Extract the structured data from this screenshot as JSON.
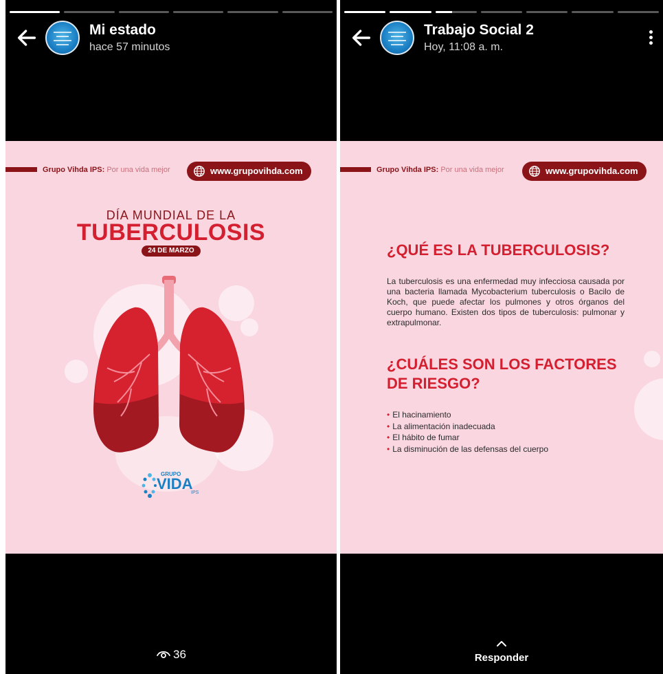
{
  "left": {
    "progress": [
      100,
      0,
      0,
      0,
      0,
      0
    ],
    "header": {
      "name": "Mi estado",
      "time": "hace 57 minutos"
    },
    "card": {
      "brand_name": "Grupo Vihda IPS:",
      "brand_tagline": "Por una vida mejor",
      "url": "www.grupovihda.com",
      "title_top": "DÍA MUNDIAL DE LA",
      "title_main": "TUBERCULOSIS",
      "date": "24 DE MARZO",
      "logo_small": "GRUPO",
      "logo_main": "VIDA",
      "logo_sub": "IPS"
    },
    "views": "36"
  },
  "right": {
    "progress": [
      100,
      100,
      40,
      0,
      0,
      0,
      0
    ],
    "header": {
      "name": "Trabajo Social 2",
      "time": "Hoy, 11:08 a. m."
    },
    "card": {
      "brand_name": "Grupo Vihda IPS:",
      "brand_tagline": "Por una vida mejor",
      "url": "www.grupovihda.com",
      "q1": "¿QUÉ ES LA TUBERCULOSIS?",
      "p1": "La tuberculosis es una enfermedad muy infecciosa causada por una bacteria llamada Mycobacterium tuberculosis o Bacilo de Koch, que puede afectar los pulmones y otros órganos del cuerpo humano. Existen dos tipos de tuberculosis: pulmonar y extrapulmonar.",
      "q2_line1": "¿CUÁLES SON LOS FACTORES",
      "q2_line2": "DE RIESGO?",
      "factors": [
        "El hacinamiento",
        "La alimentación inadecuada",
        "El hábito de fumar",
        "La disminución de las defensas del cuerpo"
      ]
    },
    "reply": "Responder"
  },
  "colors": {
    "maroon": "#8b1419",
    "red": "#d31f2f",
    "pink": "#f9d6e0",
    "avatar_blue": "#1b7fc4"
  }
}
